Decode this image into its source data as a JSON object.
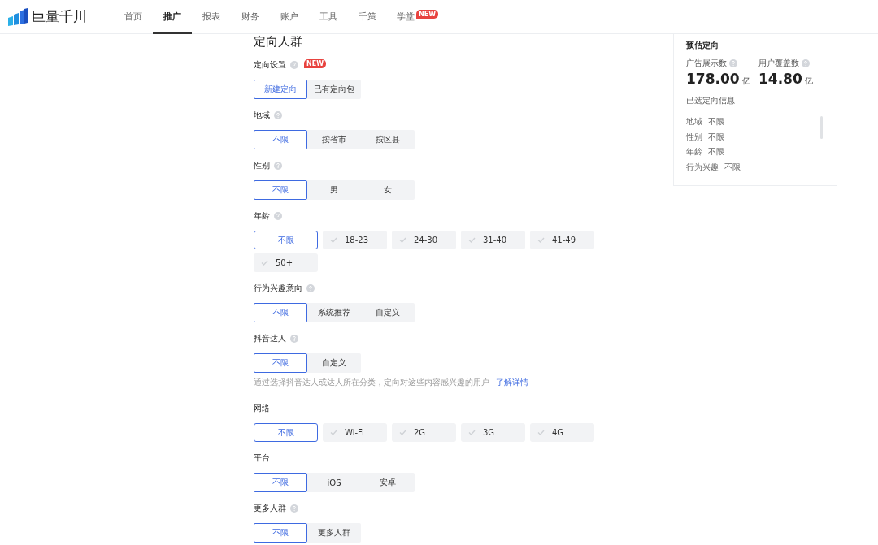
{
  "brand": "巨量千川",
  "nav": [
    {
      "label": "首页",
      "selected": false
    },
    {
      "label": "推广",
      "selected": true
    },
    {
      "label": "报表",
      "selected": false
    },
    {
      "label": "财务",
      "selected": false
    },
    {
      "label": "账户",
      "selected": false
    },
    {
      "label": "工具",
      "selected": false
    },
    {
      "label": "千策",
      "selected": false
    },
    {
      "label": "学堂",
      "selected": false,
      "badge": "NEW"
    }
  ],
  "section_title": "定向人群",
  "sections": [
    {
      "label": "定向设置",
      "help": true,
      "badge": "NEW",
      "kind": "segment",
      "options": [
        {
          "label": "新建定向",
          "selected": true
        },
        {
          "label": "已有定向包",
          "selected": false
        }
      ]
    },
    {
      "label": "地域",
      "help": true,
      "kind": "segment",
      "options": [
        {
          "label": "不限",
          "selected": true
        },
        {
          "label": "按省市",
          "selected": false
        },
        {
          "label": "按区县",
          "selected": false
        }
      ]
    },
    {
      "label": "性别",
      "help": true,
      "kind": "segment",
      "options": [
        {
          "label": "不限",
          "selected": true
        },
        {
          "label": "男",
          "selected": false
        },
        {
          "label": "女",
          "selected": false
        }
      ]
    },
    {
      "label": "年龄",
      "help": true,
      "kind": "multi",
      "options": [
        {
          "label": "不限",
          "selected": true
        },
        {
          "label": "18-23",
          "selected": false
        },
        {
          "label": "24-30",
          "selected": false
        },
        {
          "label": "31-40",
          "selected": false
        },
        {
          "label": "41-49",
          "selected": false
        },
        {
          "label": "50+",
          "selected": false
        }
      ]
    },
    {
      "label": "行为兴趣意向",
      "help": true,
      "kind": "segment",
      "options": [
        {
          "label": "不限",
          "selected": true
        },
        {
          "label": "系统推荐",
          "selected": false
        },
        {
          "label": "自定义",
          "selected": false
        }
      ]
    },
    {
      "label": "抖音达人",
      "help": true,
      "kind": "segment",
      "options": [
        {
          "label": "不限",
          "selected": true
        },
        {
          "label": "自定义",
          "selected": false
        }
      ],
      "hint": "通过选择抖音达人或达人所在分类，定向对这些内容感兴趣的用户",
      "hint_link": "了解详情"
    },
    {
      "label": "网络",
      "help": false,
      "kind": "multi",
      "options": [
        {
          "label": "不限",
          "selected": true
        },
        {
          "label": "Wi-Fi",
          "selected": false
        },
        {
          "label": "2G",
          "selected": false
        },
        {
          "label": "3G",
          "selected": false
        },
        {
          "label": "4G",
          "selected": false
        }
      ]
    },
    {
      "label": "平台",
      "help": false,
      "kind": "segment",
      "options": [
        {
          "label": "不限",
          "selected": true
        },
        {
          "label": "iOS",
          "selected": false
        },
        {
          "label": "安卓",
          "selected": false
        }
      ]
    },
    {
      "label": "更多人群",
      "help": true,
      "kind": "segment",
      "options": [
        {
          "label": "不限",
          "selected": true
        },
        {
          "label": "更多人群",
          "selected": false
        }
      ]
    }
  ],
  "summary": {
    "title": "预估定向",
    "metrics": [
      {
        "label": "广告展示数",
        "value": "178.00",
        "unit": "亿"
      },
      {
        "label": "用户覆盖数",
        "value": "14.80",
        "unit": "亿"
      }
    ],
    "info_title": "已选定向信息",
    "items": [
      {
        "name": "地域",
        "value": "不限"
      },
      {
        "name": "性别",
        "value": "不限"
      },
      {
        "name": "年龄",
        "value": "不限"
      },
      {
        "name": "行为兴趣",
        "value": "不限"
      }
    ]
  }
}
